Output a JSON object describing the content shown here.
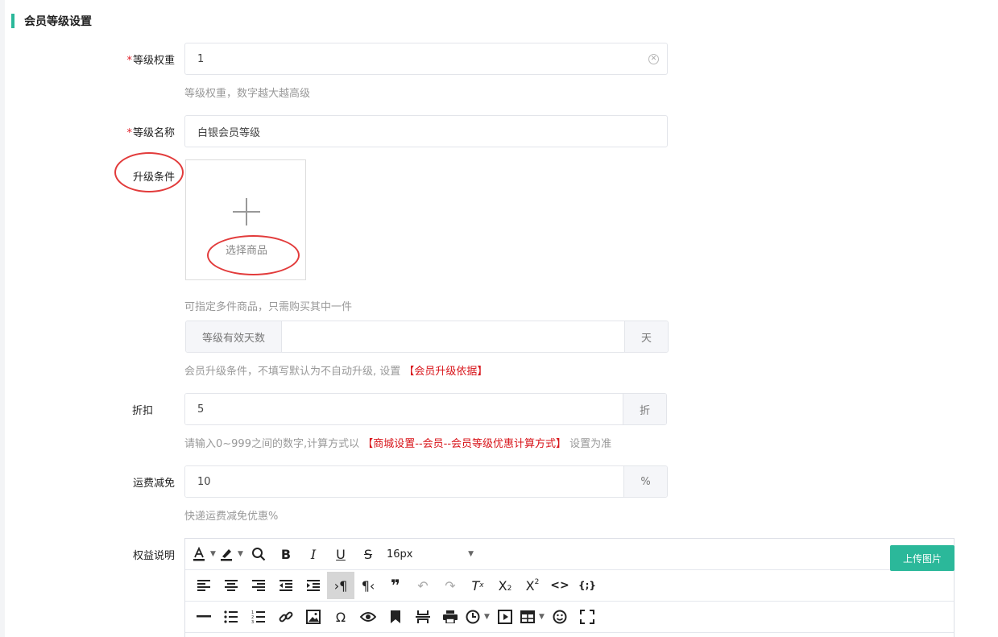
{
  "section": {
    "title": "会员等级设置"
  },
  "level_weight": {
    "label": "等级权重",
    "value": "1",
    "hint": "等级权重，数字越大越高级"
  },
  "level_name": {
    "label": "等级名称",
    "value": "白银会员等级"
  },
  "upgrade": {
    "label": "升级条件",
    "select_product": "选择商品",
    "hint": "可指定多件商品，只需购买其中一件",
    "days_prefix": "等级有效天数",
    "days_value": "",
    "days_suffix": "天",
    "hint2_text": "会员升级条件，不填写默认为不自动升级, 设置 ",
    "hint2_link": "【会员升级依据】"
  },
  "discount": {
    "label": "折扣",
    "value": "5",
    "suffix": "折",
    "hint_pre": "请输入0~999之间的数字,计算方式以 ",
    "hint_link": "【商城设置--会员--会员等级优惠计算方式】",
    "hint_post": " 设置为准"
  },
  "shipping": {
    "label": "运费减免",
    "value": "10",
    "suffix": "%",
    "hint": "快递运费减免优惠%"
  },
  "benefits": {
    "label": "权益说明"
  },
  "editor": {
    "font_size": "16px",
    "upload_image": "上传图片"
  },
  "colors": {
    "accent": "#2bb89a",
    "required": "#e0202a",
    "link_red": "#d8141a",
    "annotation": "#e23b3b"
  }
}
